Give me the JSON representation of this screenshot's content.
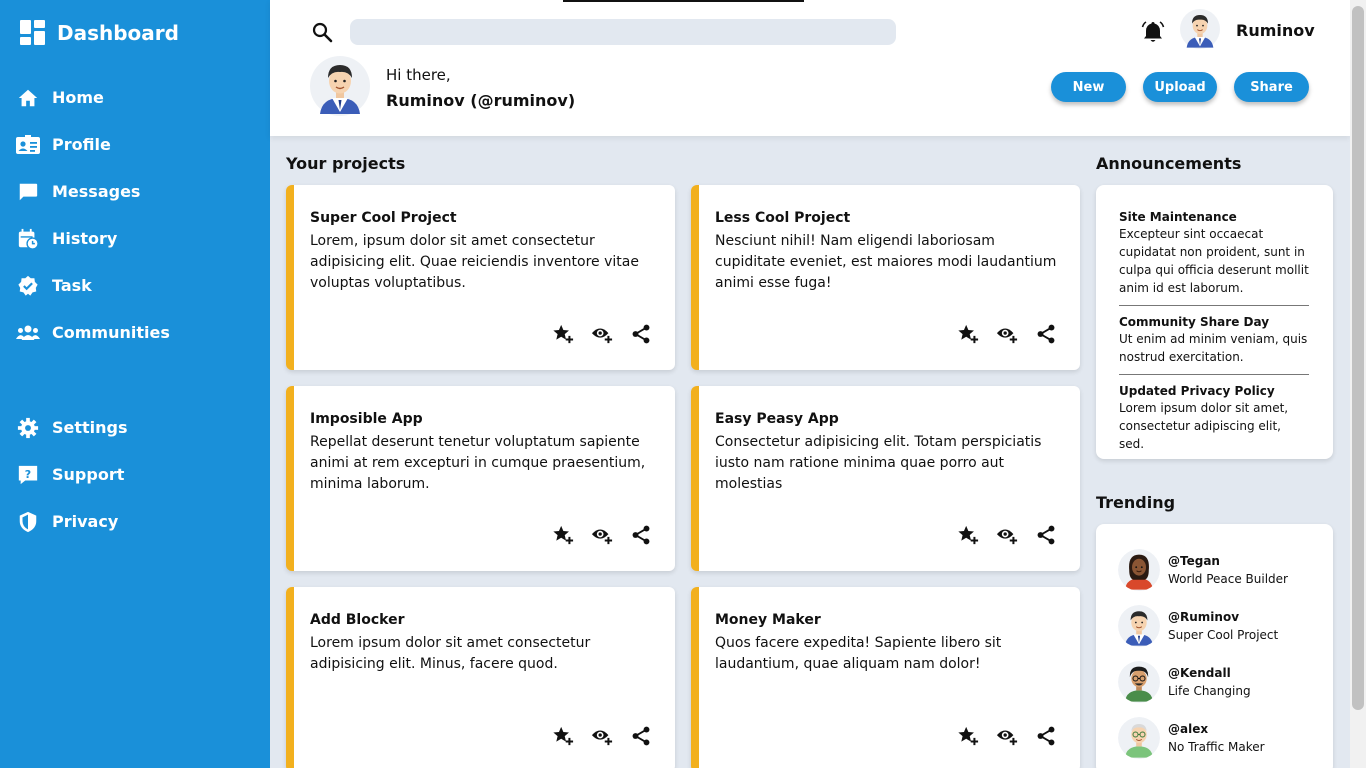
{
  "sidebar": {
    "brand": "Dashboard",
    "items": [
      {
        "label": "Home",
        "icon": "home-icon"
      },
      {
        "label": "Profile",
        "icon": "id-card-icon"
      },
      {
        "label": "Messages",
        "icon": "chat-icon"
      },
      {
        "label": "History",
        "icon": "history-icon"
      },
      {
        "label": "Task",
        "icon": "badge-check-icon"
      },
      {
        "label": "Communities",
        "icon": "users-icon"
      }
    ],
    "bottom_items": [
      {
        "label": "Settings",
        "icon": "gear-icon"
      },
      {
        "label": "Support",
        "icon": "help-icon"
      },
      {
        "label": "Privacy",
        "icon": "shield-icon"
      }
    ]
  },
  "header": {
    "search_placeholder": "",
    "username": "Ruminov",
    "greeting": "Hi there,",
    "greeting_name": "Ruminov (@ruminov)",
    "buttons": [
      "New",
      "Upload",
      "Share"
    ]
  },
  "projects": {
    "title": "Your projects",
    "items": [
      {
        "title": "Super Cool Project",
        "body": "Lorem, ipsum dolor sit amet consectetur adipisicing elit. Quae reiciendis inventore vitae voluptas voluptatibus."
      },
      {
        "title": "Less Cool Project",
        "body": "Nesciunt nihil! Nam eligendi laboriosam cupiditate eveniet, est maiores modi laudantium animi esse fuga!"
      },
      {
        "title": "Imposible App",
        "body": "Repellat deserunt tenetur voluptatum sapiente animi at rem excepturi in cumque praesentium, minima laborum."
      },
      {
        "title": "Easy Peasy App",
        "body": "Consectetur adipisicing elit. Totam perspiciatis iusto nam ratione minima quae porro aut molestias"
      },
      {
        "title": "Add Blocker",
        "body": "Lorem ipsum dolor sit amet consectetur adipisicing elit. Minus, facere quod."
      },
      {
        "title": "Money Maker",
        "body": "Quos facere expedita! Sapiente libero sit laudantium, quae aliquam nam dolor!"
      }
    ]
  },
  "announcements": {
    "title": "Announcements",
    "items": [
      {
        "title": "Site Maintenance",
        "body": "Excepteur sint occaecat cupidatat non proident, sunt in culpa qui officia deserunt mollit anim id est laborum."
      },
      {
        "title": "Community Share Day",
        "body": "Ut enim ad minim veniam, quis nostrud exercitation."
      },
      {
        "title": "Updated Privacy Policy",
        "body": "Lorem ipsum dolor sit amet, consectetur adipiscing elit, sed."
      }
    ]
  },
  "trending": {
    "title": "Trending",
    "items": [
      {
        "handle": "@Tegan",
        "subtitle": "World Peace Builder"
      },
      {
        "handle": "@Ruminov",
        "subtitle": "Super Cool Project"
      },
      {
        "handle": "@Kendall",
        "subtitle": "Life Changing"
      },
      {
        "handle": "@alex",
        "subtitle": "No Traffic Maker"
      }
    ]
  },
  "colors": {
    "primary": "#1a90d9",
    "accent": "#f2b01e",
    "background": "#e2e8f0"
  }
}
